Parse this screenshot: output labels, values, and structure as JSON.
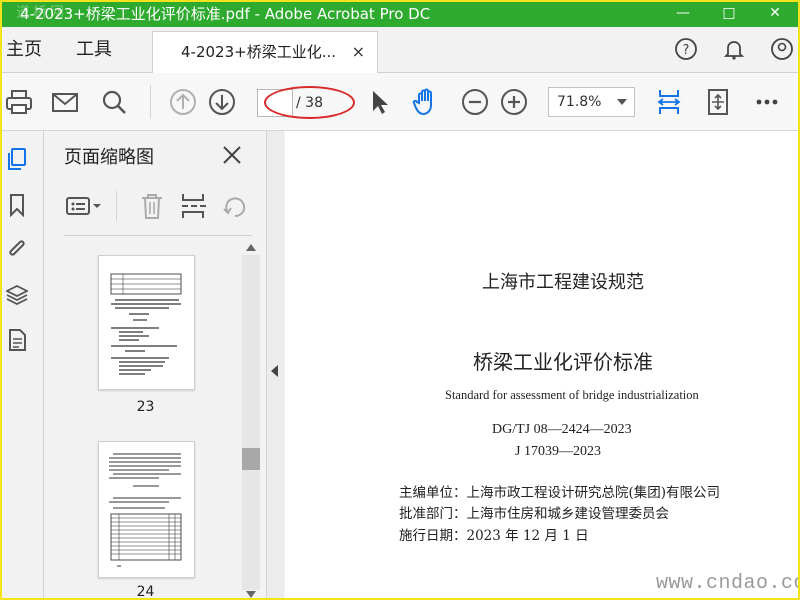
{
  "window": {
    "title": "4-2023+桥梁工业化评价标准.pdf - Adobe Acrobat Pro DC",
    "watermark": "道桥网",
    "controls": [
      "minimize-icon",
      "maximize-icon",
      "close-icon"
    ]
  },
  "tabs": {
    "home": "主页",
    "tools": "工具",
    "document": "4-2023+桥梁工业化...",
    "document_close": "×",
    "right_icons": [
      "help-icon",
      "bell-icon",
      "account-icon"
    ]
  },
  "toolbar": {
    "icons": [
      "print-icon",
      "email-icon",
      "search-icon",
      "page-up-icon",
      "page-down-icon",
      "select-cursor-icon",
      "hand-tool-icon",
      "zoom-out-icon",
      "zoom-in-icon",
      "fit-width-icon",
      "fit-page-icon",
      "more-icon"
    ],
    "current_page": "",
    "page_count": "/ 38",
    "zoom": "71.8%"
  },
  "left_rail": {
    "icons": [
      "page-thumbnails-icon",
      "bookmark-icon",
      "attachment-icon",
      "layers-icon",
      "document-properties-icon"
    ]
  },
  "thumbnails_panel": {
    "title": "页面缩略图",
    "tools": [
      "thumbnail-options-icon",
      "delete-page-icon",
      "insert-page-icon",
      "rotate-page-icon"
    ],
    "pages": [
      {
        "number": "23"
      },
      {
        "number": "24"
      }
    ]
  },
  "document": {
    "series": "上海市工程建设规范",
    "title": "桥梁工业化评价标准",
    "english_title": "Standard for assessment of bridge industrialization",
    "code": "DG/TJ 08—2424—2023",
    "record": "J 17039—2023",
    "chief_editor": "主编单位：上海市政工程设计研究总院(集团)有限公司",
    "approved_by": "批准部门：上海市住房和城乡建设管理委员会",
    "effective_date": "施行日期：2023 年 12 月 1 日"
  },
  "site_watermark": "www.cndao.com",
  "colors": {
    "title_bar": "#2eaa2e",
    "accent_blue": "#1473e6",
    "annotation_red": "#d92b2b",
    "frame_yellow": "#f6e21a"
  }
}
